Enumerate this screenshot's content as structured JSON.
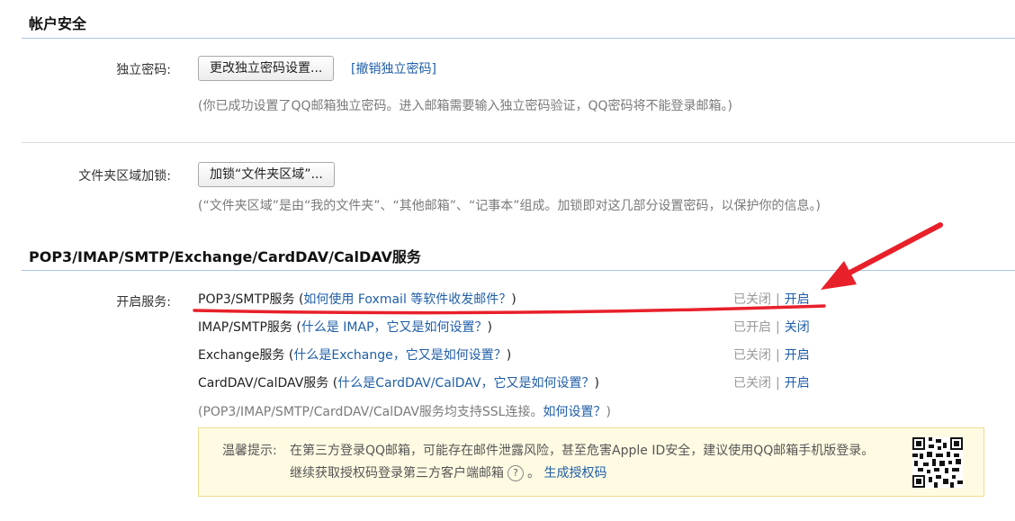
{
  "account_security": {
    "title": "帐户安全",
    "independent_password": {
      "label": "独立密码:",
      "change_button": "更改独立密码设置...",
      "revoke_link": "[撤销独立密码]",
      "note": "(你已成功设置了QQ邮箱独立密码。进入邮箱需要输入独立密码验证，QQ密码将不能登录邮箱。)"
    },
    "folder_lock": {
      "label": "文件夹区域加锁:",
      "lock_button": "加锁“文件夹区域”...",
      "note": "(“文件夹区域”是由“我的文件夹”、“其他邮箱”、“记事本”组成。加锁即对这几部分设置密码，以保护你的信息。)"
    }
  },
  "services": {
    "title": "POP3/IMAP/SMTP/Exchange/CardDAV/CalDAV服务",
    "label": "开启服务:",
    "rows": [
      {
        "name": "POP3/SMTP服务",
        "open_paren": "(",
        "help_link": "如何使用 Foxmail 等软件收发邮件？",
        "close_paren": ")",
        "status": "已关闭",
        "separator": "|",
        "action": "开启"
      },
      {
        "name": "IMAP/SMTP服务",
        "open_paren": "(",
        "help_link": "什么是 IMAP，它又是如何设置？",
        "close_paren": ")",
        "status": "已开启",
        "separator": "|",
        "action": "关闭"
      },
      {
        "name": "Exchange服务",
        "open_paren": "(",
        "help_link": "什么是Exchange，它又是如何设置？",
        "close_paren": ")",
        "status": "已关闭",
        "separator": "|",
        "action": "开启"
      },
      {
        "name": "CardDAV/CalDAV服务",
        "open_paren": "(",
        "help_link": "什么是CardDAV/CalDAV，它又是如何设置？",
        "close_paren": ")",
        "status": "已关闭",
        "separator": "|",
        "action": "开启"
      }
    ],
    "ssl_note_prefix": "(POP3/IMAP/SMTP/CardDAV/CalDAV服务均支持SSL连接。",
    "ssl_note_link": "如何设置？",
    "ssl_note_suffix": ")",
    "tip": {
      "label": "温馨提示:",
      "line1": "在第三方登录QQ邮箱，可能存在邮件泄露风险，甚至危害Apple ID安全，建议使用QQ邮箱手机版登录。",
      "line2": "继续获取授权码登录第三方客户端邮箱",
      "help_icon_glyph": "?",
      "line2_period": "。",
      "generate_link": "生成授权码"
    }
  },
  "colors": {
    "link": "#1f5ea8",
    "annotation_red": "#e8202a",
    "rule_blue": "#aac6e3",
    "tip_bg": "#fffbe3"
  }
}
